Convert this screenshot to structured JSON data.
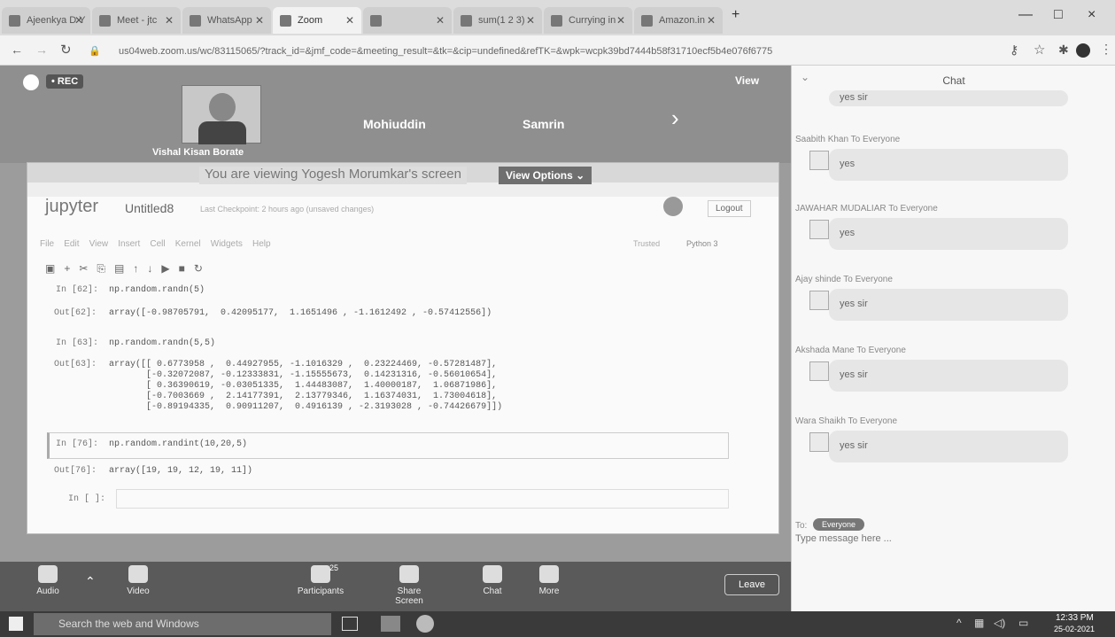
{
  "browser": {
    "tabs": [
      {
        "label": "Ajeenkya D Y",
        "active": false
      },
      {
        "label": "Meet - jtc",
        "active": false
      },
      {
        "label": "WhatsApp",
        "active": false
      },
      {
        "label": "Zoom",
        "active": true
      },
      {
        "label": "",
        "active": false
      },
      {
        "label": "sum(1 2 3)",
        "active": false
      },
      {
        "label": "Currying in",
        "active": false
      },
      {
        "label": "Amazon.in",
        "active": false
      }
    ],
    "url": "us04web.zoom.us/wc/83115065/?track_id=&jmf_code=&meeting_result=&tk=&cip=undefined&refTK=&wpk=wcpk39bd7444b58f31710ecf5b4e076f6775",
    "new_tab": "+",
    "min": "—",
    "max": "□",
    "close": "×"
  },
  "zoom": {
    "rec_label": "• REC",
    "view_label": "View",
    "participants": [
      "Vishal Kisan Borate",
      "Mohiuddin",
      "Samrin"
    ],
    "banner": "You are viewing Yogesh Morumkar's screen",
    "view_options": "View Options",
    "toolbar": {
      "audio": "Audio",
      "video": "Video",
      "participants": "Participants",
      "participants_count": "25",
      "share": "Share Screen",
      "chat": "Chat",
      "more": "More",
      "leave": "Leave"
    }
  },
  "jupyter": {
    "logo": "jupyter",
    "notebook": "Untitled8",
    "checkpoint": "Last Checkpoint: 2 hours ago  (unsaved changes)",
    "logout": "Logout",
    "trusted": "Trusted",
    "kernel": "Python 3",
    "menu": [
      "File",
      "Edit",
      "View",
      "Insert",
      "Cell",
      "Kernel",
      "Widgets",
      "Help"
    ],
    "cells": [
      {
        "in": "In [62]:",
        "code": "np.random.randn(5)",
        "out": "Out[62]:",
        "result": "array([-0.98705791,  0.42095177,  1.1651496 , -1.1612492 , -0.57412556])"
      },
      {
        "in": "In [63]:",
        "code": "np.random.randn(5,5)",
        "out": "Out[63]:",
        "result": "array([[ 0.6773958 ,  0.44927955, -1.1016329 ,  0.23224469, -0.57281487],\n       [-0.32072087, -0.12333831, -1.15555673,  0.14231316, -0.56010654],\n       [ 0.36390619, -0.03051335,  1.44483087,  1.40000187,  1.06871986],\n       [-0.7003669 ,  2.14177391,  2.13779346,  1.16374031,  1.73004618],\n       [-0.89194335,  0.90911207,  0.4916139 , -2.3193028 , -0.74426679]])"
      },
      {
        "in": "In [76]:",
        "code": "np.random.randint(10,20,5)",
        "out": "Out[76]:",
        "result": "array([19, 19, 12, 19, 11])"
      },
      {
        "in": "In [ ]:",
        "code": "",
        "out": "",
        "result": ""
      }
    ]
  },
  "chat": {
    "title": "Chat",
    "messages": [
      {
        "from": "",
        "text": "yes sir"
      },
      {
        "from": "Saabith Khan  To  Everyone",
        "text": "yes"
      },
      {
        "from": "JAWAHAR MUDALIAR  To  Everyone",
        "text": "yes"
      },
      {
        "from": "Ajay shinde  To  Everyone",
        "text": "yes sir"
      },
      {
        "from": "Akshada Mane  To  Everyone",
        "text": "yes sir"
      },
      {
        "from": "Wara Shaikh  To  Everyone",
        "text": "yes sir"
      }
    ],
    "to_label": "To:",
    "to_value": "Everyone",
    "placeholder": "Type message here ..."
  },
  "taskbar": {
    "search": "Search the web and Windows",
    "time": "12:33 PM",
    "date": "25-02-2021"
  }
}
